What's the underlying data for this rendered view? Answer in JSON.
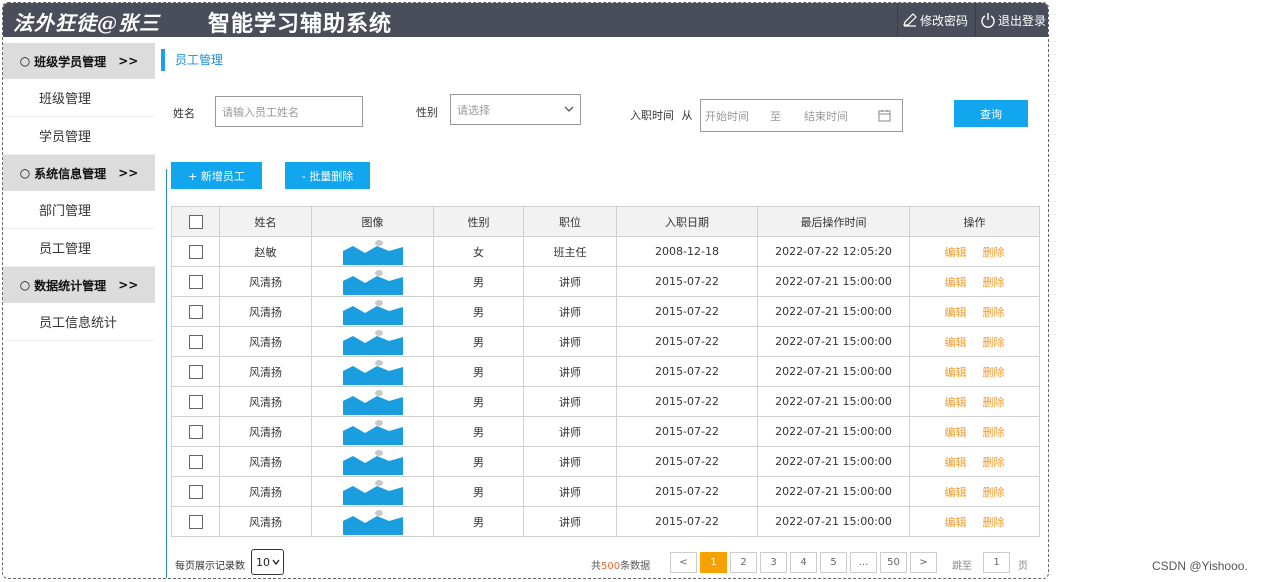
{
  "header": {
    "brand": "法外狂徒@张三",
    "title": "智能学习辅助系统",
    "change_password": "修改密码",
    "logout": "退出登录"
  },
  "sidebar": {
    "groups": [
      {
        "label": "班级学员管理",
        "bullet": "○",
        "arrow": ">>",
        "items": [
          "班级管理",
          "学员管理"
        ]
      },
      {
        "label": "系统信息管理",
        "bullet": "○",
        "arrow": ">>",
        "items": [
          "部门管理",
          "员工管理"
        ]
      },
      {
        "label": "数据统计管理",
        "bullet": "○",
        "arrow": ">>",
        "items": [
          "员工信息统计"
        ]
      }
    ]
  },
  "breadcrumb": "员工管理",
  "search": {
    "name_label": "姓名",
    "name_placeholder": "请输入员工姓名",
    "gender_label": "性别",
    "gender_placeholder": "请选择",
    "date_label": "入职时间",
    "date_label_suffix": "从",
    "date_start_placeholder": "开始时间",
    "date_sep": "至",
    "date_end_placeholder": "结束时间",
    "query_button": "查询"
  },
  "actions": {
    "add": "+ 新增员工",
    "batch_delete": "- 批量删除"
  },
  "table": {
    "headers": [
      "姓名",
      "图像",
      "性别",
      "职位",
      "入职日期",
      "最后操作时间",
      "操作"
    ],
    "edit_label": "编辑",
    "delete_label": "删除",
    "rows": [
      {
        "name": "赵敏",
        "gender": "女",
        "position": "班主任",
        "entry_date": "2008-12-18",
        "updated": "2022-07-22 12:05:20"
      },
      {
        "name": "风清扬",
        "gender": "男",
        "position": "讲师",
        "entry_date": "2015-07-22",
        "updated": "2022-07-21 15:00:00"
      },
      {
        "name": "风清扬",
        "gender": "男",
        "position": "讲师",
        "entry_date": "2015-07-22",
        "updated": "2022-07-21 15:00:00"
      },
      {
        "name": "风清扬",
        "gender": "男",
        "position": "讲师",
        "entry_date": "2015-07-22",
        "updated": "2022-07-21 15:00:00"
      },
      {
        "name": "风清扬",
        "gender": "男",
        "position": "讲师",
        "entry_date": "2015-07-22",
        "updated": "2022-07-21 15:00:00"
      },
      {
        "name": "风清扬",
        "gender": "男",
        "position": "讲师",
        "entry_date": "2015-07-22",
        "updated": "2022-07-21 15:00:00"
      },
      {
        "name": "风清扬",
        "gender": "男",
        "position": "讲师",
        "entry_date": "2015-07-22",
        "updated": "2022-07-21 15:00:00"
      },
      {
        "name": "风清扬",
        "gender": "男",
        "position": "讲师",
        "entry_date": "2015-07-22",
        "updated": "2022-07-21 15:00:00"
      },
      {
        "name": "风清扬",
        "gender": "男",
        "position": "讲师",
        "entry_date": "2015-07-22",
        "updated": "2022-07-21 15:00:00"
      },
      {
        "name": "风清扬",
        "gender": "男",
        "position": "讲师",
        "entry_date": "2015-07-22",
        "updated": "2022-07-21 15:00:00"
      }
    ]
  },
  "pagination": {
    "page_size_label": "每页展示记录数",
    "page_size_value": "10",
    "total_prefix": "共",
    "total_count": "500",
    "total_suffix": "条数据",
    "prev": "<",
    "pages": [
      "1",
      "2",
      "3",
      "4",
      "5",
      "...",
      "50"
    ],
    "active_page": "1",
    "next": ">",
    "goto_label": "跳至",
    "goto_value": "1",
    "goto_suffix": "页"
  },
  "watermark": "CSDN @Yishooo.",
  "colors": {
    "header_bg": "#4a4e5a",
    "primary": "#11a6ee",
    "action_link": "#f39a2b",
    "active_page": "#f7a100",
    "total_highlight": "#ef6b3b"
  }
}
